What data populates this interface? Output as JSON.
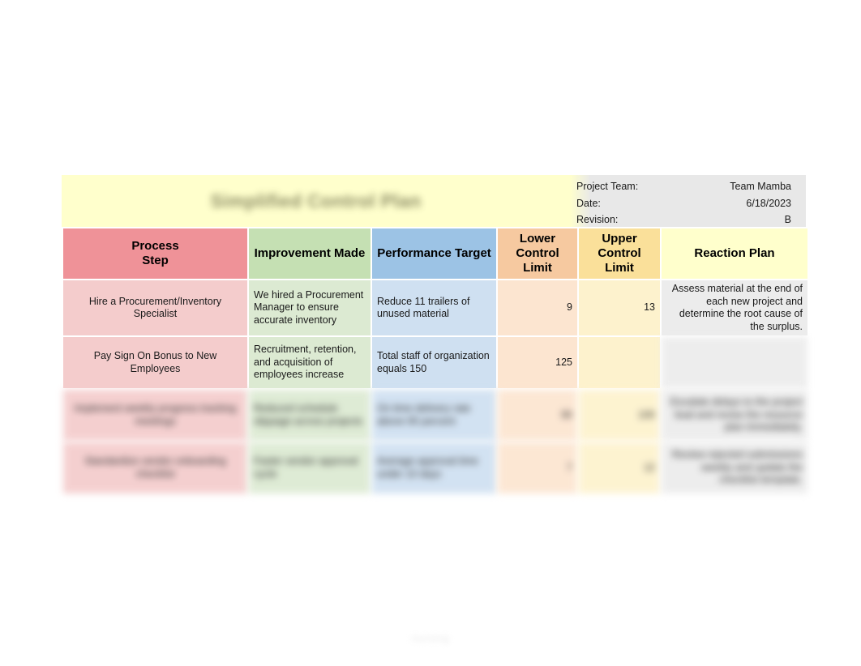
{
  "document": {
    "title": "Simplified Control Plan",
    "watermark": "nursing"
  },
  "meta": [
    {
      "label": "Project Team:",
      "value": "Team Mamba"
    },
    {
      "label": "Date:",
      "value": "6/18/2023"
    },
    {
      "label": "Revision:",
      "value": "B"
    }
  ],
  "table": {
    "headers": {
      "process_step": "Process\nStep",
      "improvement_made": "Improvement Made",
      "performance_target": "Performance Target",
      "lower_control_limit": "Lower\nControl Limit",
      "upper_control_limit": "Upper\nControl Limit",
      "reaction_plan": "Reaction Plan"
    },
    "rows": [
      {
        "redacted": false,
        "process_step": "Hire a Procurement/Inventory Specialist",
        "improvement_made": "We hired a Procurement Manager to ensure accurate inventory",
        "performance_target": "Reduce 11 trailers of unused material",
        "lower_control_limit": "9",
        "upper_control_limit": "13",
        "reaction_plan": "Assess material at the end of each new project and determine the root cause of the surplus."
      },
      {
        "redacted": false,
        "process_step": "Pay Sign On Bonus to New Employees",
        "improvement_made": "Recruitment, retention, and acquisition of employees increase",
        "performance_target": "Total staff of organization equals 150",
        "lower_control_limit": "125",
        "upper_control_limit": "",
        "reaction_plan": ""
      },
      {
        "redacted": true,
        "process_step": "Implement weekly progress tracking meetings",
        "improvement_made": "Reduced schedule slippage across projects",
        "performance_target": "On time delivery rate above 95 percent",
        "lower_control_limit": "90",
        "upper_control_limit": "100",
        "reaction_plan": "Escalate delays to the project lead and revise the resource plan immediately."
      },
      {
        "redacted": true,
        "process_step": "Standardize vendor onboarding checklist",
        "improvement_made": "Faster vendor approval cycle",
        "performance_target": "Average approval time under 10 days",
        "lower_control_limit": "7",
        "upper_control_limit": "12",
        "reaction_plan": "Review rejected submissions weekly and update the checklist template."
      }
    ]
  },
  "colors": {
    "header_process": "#ef9298",
    "header_improvement": "#c5e0b3",
    "header_target": "#9cc3e5",
    "header_lcl": "#f6c9a0",
    "header_ucl": "#fae09a",
    "header_plan": "#ffffcc",
    "title_band": "#ffffcc",
    "meta_band": "#e8e8e8"
  }
}
